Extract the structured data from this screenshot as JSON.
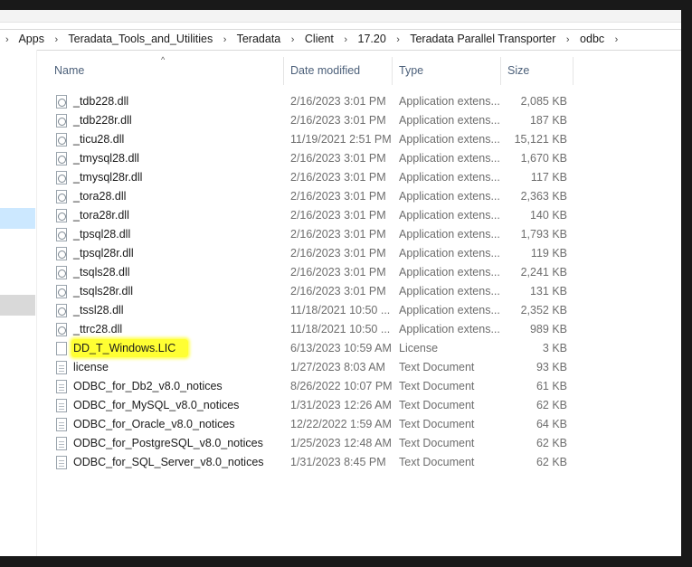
{
  "breadcrumb": [
    "Apps",
    "Teradata_Tools_and_Utilities",
    "Teradata",
    "Client",
    "17.20",
    "Teradata Parallel Transporter",
    "odbc"
  ],
  "breadcrumb_separator": "›",
  "columns": {
    "name": "Name",
    "date": "Date modified",
    "type": "Type",
    "size": "Size"
  },
  "sort_indicator": "^",
  "highlight_color": "#ffff33",
  "files": [
    {
      "name": "_tdb228.dll",
      "date": "2/16/2023 3:01 PM",
      "type": "Application extens...",
      "size": "2,085 KB",
      "icon": "dll-file-icon"
    },
    {
      "name": "_tdb228r.dll",
      "date": "2/16/2023 3:01 PM",
      "type": "Application extens...",
      "size": "187 KB",
      "icon": "dll-file-icon"
    },
    {
      "name": "_ticu28.dll",
      "date": "11/19/2021 2:51 PM",
      "type": "Application extens...",
      "size": "15,121 KB",
      "icon": "dll-file-icon"
    },
    {
      "name": "_tmysql28.dll",
      "date": "2/16/2023 3:01 PM",
      "type": "Application extens...",
      "size": "1,670 KB",
      "icon": "dll-file-icon"
    },
    {
      "name": "_tmysql28r.dll",
      "date": "2/16/2023 3:01 PM",
      "type": "Application extens...",
      "size": "117 KB",
      "icon": "dll-file-icon"
    },
    {
      "name": "_tora28.dll",
      "date": "2/16/2023 3:01 PM",
      "type": "Application extens...",
      "size": "2,363 KB",
      "icon": "dll-file-icon"
    },
    {
      "name": "_tora28r.dll",
      "date": "2/16/2023 3:01 PM",
      "type": "Application extens...",
      "size": "140 KB",
      "icon": "dll-file-icon"
    },
    {
      "name": "_tpsql28.dll",
      "date": "2/16/2023 3:01 PM",
      "type": "Application extens...",
      "size": "1,793 KB",
      "icon": "dll-file-icon"
    },
    {
      "name": "_tpsql28r.dll",
      "date": "2/16/2023 3:01 PM",
      "type": "Application extens...",
      "size": "119 KB",
      "icon": "dll-file-icon"
    },
    {
      "name": "_tsqls28.dll",
      "date": "2/16/2023 3:01 PM",
      "type": "Application extens...",
      "size": "2,241 KB",
      "icon": "dll-file-icon"
    },
    {
      "name": "_tsqls28r.dll",
      "date": "2/16/2023 3:01 PM",
      "type": "Application extens...",
      "size": "131 KB",
      "icon": "dll-file-icon"
    },
    {
      "name": "_tssl28.dll",
      "date": "11/18/2021 10:50 ...",
      "type": "Application extens...",
      "size": "2,352 KB",
      "icon": "dll-file-icon"
    },
    {
      "name": "_ttrc28.dll",
      "date": "11/18/2021 10:50 ...",
      "type": "Application extens...",
      "size": "989 KB",
      "icon": "dll-file-icon"
    },
    {
      "name": "DD_T_Windows.LIC",
      "date": "6/13/2023 10:59 AM",
      "type": "License",
      "size": "3 KB",
      "icon": "blank-file-icon",
      "highlighted": true
    },
    {
      "name": "license",
      "date": "1/27/2023 8:03 AM",
      "type": "Text Document",
      "size": "93 KB",
      "icon": "text-file-icon"
    },
    {
      "name": "ODBC_for_Db2_v8.0_notices",
      "date": "8/26/2022 10:07 PM",
      "type": "Text Document",
      "size": "61 KB",
      "icon": "text-file-icon"
    },
    {
      "name": "ODBC_for_MySQL_v8.0_notices",
      "date": "1/31/2023 12:26 AM",
      "type": "Text Document",
      "size": "62 KB",
      "icon": "text-file-icon"
    },
    {
      "name": "ODBC_for_Oracle_v8.0_notices",
      "date": "12/22/2022 1:59 AM",
      "type": "Text Document",
      "size": "64 KB",
      "icon": "text-file-icon"
    },
    {
      "name": "ODBC_for_PostgreSQL_v8.0_notices",
      "date": "1/25/2023 12:48 AM",
      "type": "Text Document",
      "size": "62 KB",
      "icon": "text-file-icon"
    },
    {
      "name": "ODBC_for_SQL_Server_v8.0_notices",
      "date": "1/31/2023 8:45 PM",
      "type": "Text Document",
      "size": "62 KB",
      "icon": "text-file-icon"
    }
  ]
}
